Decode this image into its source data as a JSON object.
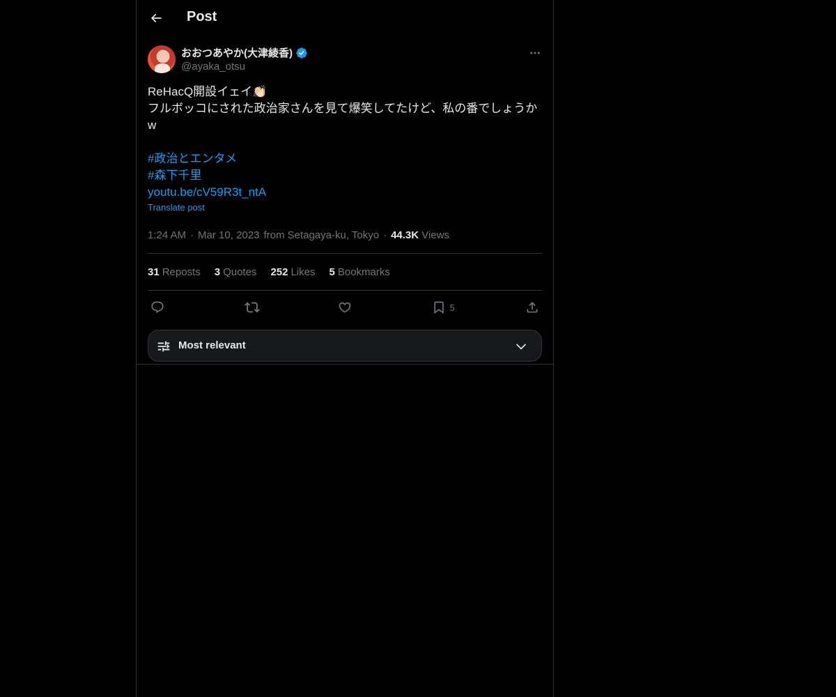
{
  "header": {
    "title": "Post",
    "back_icon": "arrow-left-icon"
  },
  "author": {
    "display_name": "おおつあやか(大津綾香)",
    "handle": "@ayaka_otsu",
    "verified": true,
    "verified_color": "#1d9bf0"
  },
  "post": {
    "lines": [
      "ReHacQ開設イェイ👏🏻",
      "フルボッコにされた政治家さんを見て爆笑してたけど、私の番でしょうか",
      "w",
      "",
      "#政治とエンタメ",
      "#森下千里",
      "youtu.be/cV59R3t_ntA"
    ],
    "translate_label": "Translate post",
    "time": "1:24 AM",
    "date": "Mar 10, 2023",
    "location": "from Setagaya-ku, Tokyo",
    "views_count": "44.3K",
    "views_label": "Views",
    "separator": "·"
  },
  "stats": {
    "reposts_count": "31",
    "reposts_label": "Reposts",
    "quotes_count": "3",
    "quotes_label": "Quotes",
    "likes_count": "252",
    "likes_label": "Likes",
    "bookmarks_count": "5",
    "bookmarks_label": "Bookmarks"
  },
  "actions": {
    "reply_icon": "reply-icon",
    "repost_icon": "repost-icon",
    "like_icon": "heart-icon",
    "bookmark_icon": "bookmark-icon",
    "bookmark_count": "5",
    "share_icon": "share-icon"
  },
  "sort": {
    "label": "Most relevant",
    "icon": "sliders-icon",
    "chevron": "chevron-down-icon"
  },
  "colors": {
    "background": "#000000",
    "text": "#e7e9ea",
    "muted": "#71767b",
    "accent": "#1d9bf0",
    "border": "#2f3336"
  }
}
